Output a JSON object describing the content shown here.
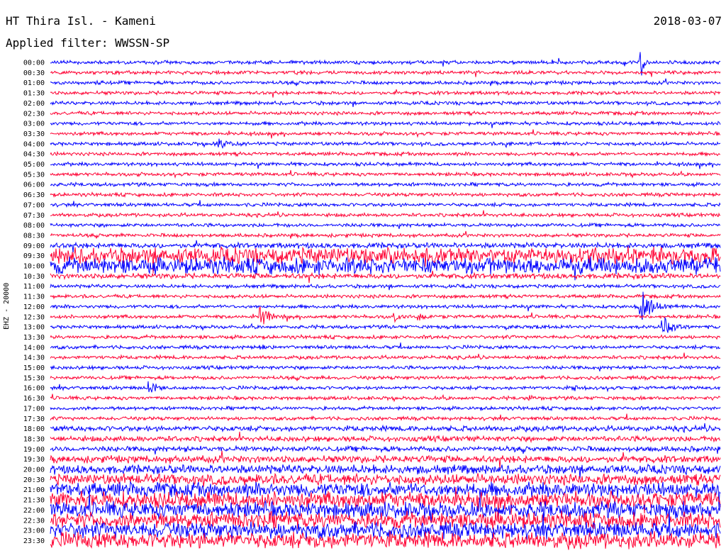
{
  "header": {
    "station": "HT Thira Isl. - Kameni",
    "date": "2018-03-07",
    "filter": "Applied filter: WWSSN-SP"
  },
  "chart_data": {
    "type": "line",
    "title": "HT Thira Isl. - Kameni",
    "ylabel": "EHZ - 20000",
    "row_labels": [
      "00:00",
      "00:30",
      "01:00",
      "01:30",
      "02:00",
      "02:30",
      "03:00",
      "03:30",
      "04:00",
      "04:30",
      "05:00",
      "05:30",
      "06:00",
      "06:30",
      "07:00",
      "07:30",
      "08:00",
      "08:30",
      "09:00",
      "09:30",
      "10:00",
      "10:30",
      "11:00",
      "11:30",
      "12:00",
      "12:30",
      "13:00",
      "13:30",
      "14:00",
      "14:30",
      "15:00",
      "15:30",
      "16:00",
      "16:30",
      "17:00",
      "17:30",
      "18:00",
      "18:30",
      "19:00",
      "19:30",
      "20:00",
      "20:30",
      "21:00",
      "21:30",
      "22:00",
      "22:30",
      "23:00",
      "23:30"
    ],
    "series_colors": [
      "#0000ff",
      "#ff0033"
    ],
    "row_minutes": 30,
    "noise_amplitude": [
      2,
      2,
      2,
      2,
      2,
      2,
      2,
      2,
      2,
      2,
      2,
      2,
      2,
      2,
      2,
      2,
      2,
      2,
      3,
      9,
      9,
      3,
      2,
      2,
      2,
      2,
      2,
      2,
      2,
      2,
      2,
      2,
      2,
      2,
      2,
      2,
      3,
      3,
      3,
      4,
      5,
      6,
      8,
      9,
      9,
      9,
      9,
      9
    ],
    "events": [
      {
        "row": 0,
        "minute": 26.5,
        "amp": 30,
        "dur": 0.3
      },
      {
        "row": 8,
        "minute": 7.5,
        "amp": 10,
        "dur": 2.0
      },
      {
        "row": 8,
        "minute": 20.5,
        "amp": 6,
        "dur": 1.0
      },
      {
        "row": 10,
        "minute": 11.0,
        "amp": 5,
        "dur": 1.0
      },
      {
        "row": 19,
        "minute": 14.0,
        "amp": 10,
        "dur": 16.0
      },
      {
        "row": 20,
        "minute": 16.0,
        "amp": 14,
        "dur": 14.0
      },
      {
        "row": 24,
        "minute": 26.5,
        "amp": 35,
        "dur": 1.5
      },
      {
        "row": 25,
        "minute": 9.5,
        "amp": 22,
        "dur": 1.0
      },
      {
        "row": 25,
        "minute": 15.5,
        "amp": 8,
        "dur": 1.0
      },
      {
        "row": 25,
        "minute": 16.5,
        "amp": 10,
        "dur": 1.0
      },
      {
        "row": 26,
        "minute": 27.5,
        "amp": 18,
        "dur": 1.5
      },
      {
        "row": 26,
        "minute": 20.5,
        "amp": 5,
        "dur": 2.5
      },
      {
        "row": 28,
        "minute": 9.5,
        "amp": 6,
        "dur": 1.0
      },
      {
        "row": 31,
        "minute": 12.5,
        "amp": 5,
        "dur": 0.6
      },
      {
        "row": 32,
        "minute": 4.5,
        "amp": 14,
        "dur": 1.2
      },
      {
        "row": 32,
        "minute": 23.5,
        "amp": 5,
        "dur": 0.5
      },
      {
        "row": 33,
        "minute": 21.5,
        "amp": 6,
        "dur": 0.6
      }
    ]
  }
}
